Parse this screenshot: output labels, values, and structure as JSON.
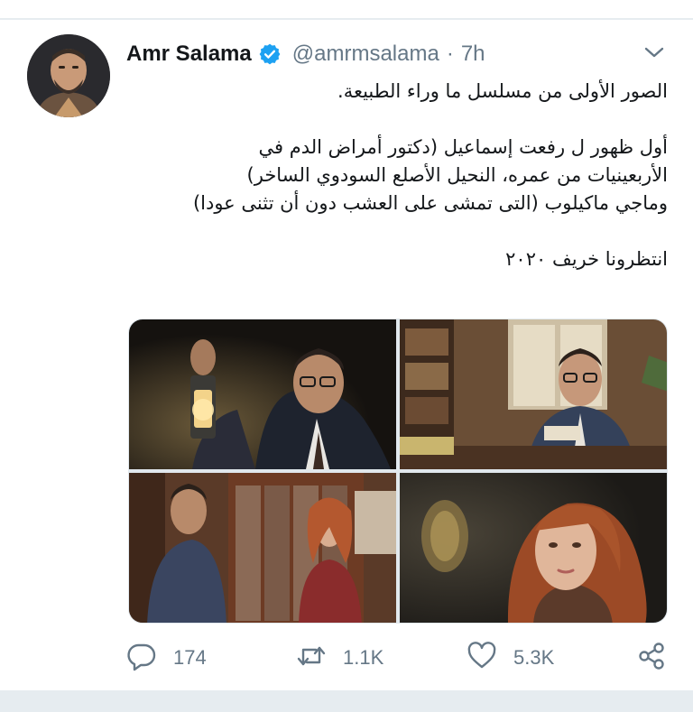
{
  "tweet": {
    "author": {
      "display_name": "Amr Salama",
      "handle": "@amrmsalama",
      "verified": true,
      "avatar_icon": "profile-photo"
    },
    "separator": "·",
    "time": "7h",
    "menu_icon": "chevron-down-icon",
    "text_lines": [
      "الصور الأولى من مسلسل ما وراء الطبيعة.",
      "",
      "أول ظهور ل رفعت إسماعيل (دكتور أمراض الدم في",
      "الأربعينيات من عمره، النحيل الأصلع السودوي الساخر)",
      "وماجي ماكيلوب (التى تمشى على العشب دون أن تثنى عودا)",
      "",
      "انتظرونا خريف ٢٠٢٠"
    ],
    "media": [
      {
        "icon": "photo-man-with-lantern"
      },
      {
        "icon": "photo-man-at-desk"
      },
      {
        "icon": "photo-man-and-woman-bookshelves"
      },
      {
        "icon": "photo-red-haired-woman"
      }
    ],
    "actions": {
      "reply": {
        "icon": "reply-icon",
        "count": "174"
      },
      "retweet": {
        "icon": "retweet-icon",
        "count": "1.1K"
      },
      "like": {
        "icon": "heart-icon",
        "count": "5.3K"
      },
      "share": {
        "icon": "share-icon"
      }
    },
    "colors": {
      "verified_blue": "#1da1f2",
      "secondary_text": "#657786",
      "divider": "#e6ecf0"
    }
  }
}
